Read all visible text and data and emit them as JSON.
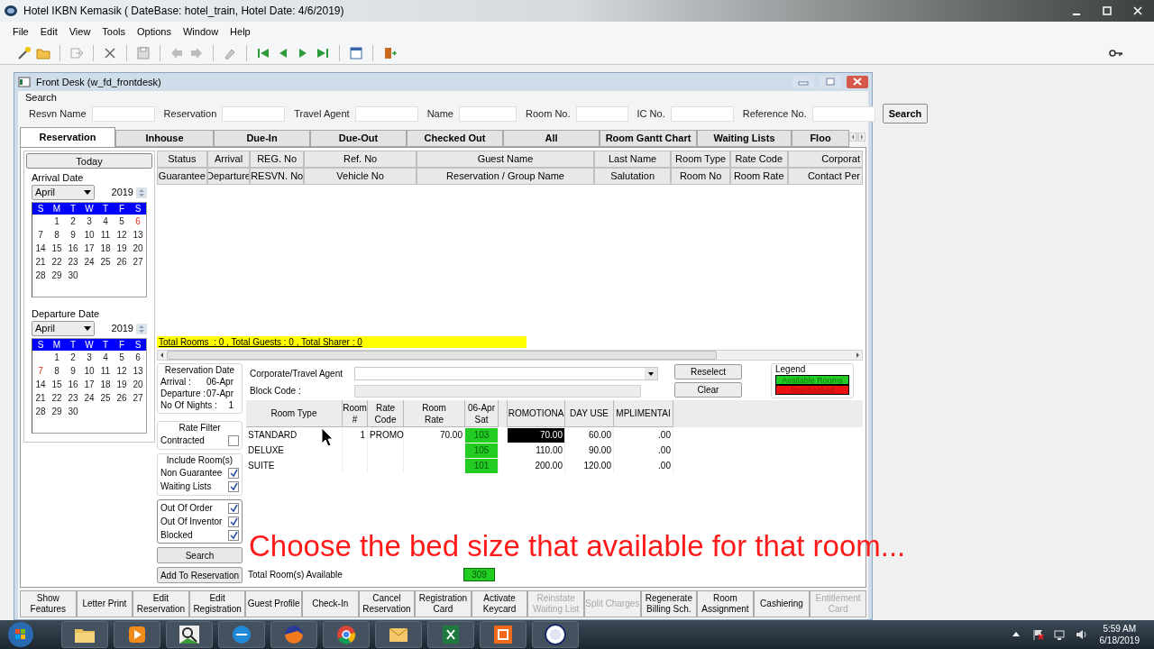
{
  "window": {
    "title": "Hotel IKBN Kemasik ( DateBase: hotel_train, Hotel Date: 4/6/2019)"
  },
  "menu": [
    "File",
    "Edit",
    "View",
    "Tools",
    "Options",
    "Window",
    "Help"
  ],
  "front_desk": {
    "title": "Front Desk (w_fd_frontdesk)",
    "search": {
      "legend": "Search",
      "fields": [
        {
          "label": "Resvn Name"
        },
        {
          "label": "Reservation"
        },
        {
          "label": "Travel Agent"
        },
        {
          "label": "Name"
        },
        {
          "label": "Room No."
        },
        {
          "label": "IC No."
        },
        {
          "label": "Reference No."
        }
      ],
      "button": "Search"
    },
    "tabs": [
      {
        "label": "Reservation",
        "selected": true
      },
      {
        "label": "Inhouse",
        "selected": false
      },
      {
        "label": "Due-In",
        "selected": false
      },
      {
        "label": "Due-Out",
        "selected": false
      },
      {
        "label": "Checked Out",
        "selected": false
      },
      {
        "label": "All",
        "selected": false
      },
      {
        "label": "Room Gantt Chart",
        "selected": false
      },
      {
        "label": "Waiting Lists",
        "selected": false
      },
      {
        "label": "Floo",
        "selected": false
      }
    ],
    "today_button": "Today",
    "calendars": [
      {
        "legend": "Arrival Date",
        "month": "April",
        "year": "2019",
        "weekdays": [
          "S",
          "M",
          "T",
          "W",
          "T",
          "F",
          "S"
        ],
        "weeks": [
          {
            "days": [
              {
                "d": "1",
                "marked": false
              },
              {
                "d": "2",
                "marked": false
              },
              {
                "d": "3",
                "marked": false
              },
              {
                "d": "4",
                "marked": false
              },
              {
                "d": "5",
                "marked": false
              },
              {
                "d": "6",
                "marked": true
              }
            ]
          },
          {
            "days": [
              {
                "d": "7",
                "marked": false
              },
              {
                "d": "8",
                "marked": false
              },
              {
                "d": "9",
                "marked": false
              },
              {
                "d": "10",
                "marked": false
              },
              {
                "d": "11",
                "marked": false
              },
              {
                "d": "12",
                "marked": false
              },
              {
                "d": "13",
                "marked": false
              }
            ]
          },
          {
            "days": [
              {
                "d": "14",
                "marked": false
              },
              {
                "d": "15",
                "marked": false
              },
              {
                "d": "16",
                "marked": false
              },
              {
                "d": "17",
                "marked": false
              },
              {
                "d": "18",
                "marked": false
              },
              {
                "d": "19",
                "marked": false
              },
              {
                "d": "20",
                "marked": false
              }
            ]
          },
          {
            "days": [
              {
                "d": "21",
                "marked": false
              },
              {
                "d": "22",
                "marked": false
              },
              {
                "d": "23",
                "marked": false
              },
              {
                "d": "24",
                "marked": false
              },
              {
                "d": "25",
                "marked": false
              },
              {
                "d": "26",
                "marked": false
              },
              {
                "d": "27",
                "marked": false
              }
            ]
          },
          {
            "days": [
              {
                "d": "28",
                "marked": false
              },
              {
                "d": "29",
                "marked": false
              },
              {
                "d": "30",
                "marked": false
              }
            ]
          }
        ]
      },
      {
        "legend": "Departure Date",
        "month": "April",
        "year": "2019",
        "weekdays": [
          "S",
          "M",
          "T",
          "W",
          "T",
          "F",
          "S"
        ],
        "weeks": [
          {
            "days": [
              {
                "d": "1",
                "marked": false
              },
              {
                "d": "2",
                "marked": false
              },
              {
                "d": "3",
                "marked": false
              },
              {
                "d": "4",
                "marked": false
              },
              {
                "d": "5",
                "marked": false
              },
              {
                "d": "6",
                "marked": false
              }
            ]
          },
          {
            "days": [
              {
                "d": "7",
                "marked": true
              },
              {
                "d": "8",
                "marked": false
              },
              {
                "d": "9",
                "marked": false
              },
              {
                "d": "10",
                "marked": false
              },
              {
                "d": "11",
                "marked": false
              },
              {
                "d": "12",
                "marked": false
              },
              {
                "d": "13",
                "marked": false
              }
            ]
          },
          {
            "days": [
              {
                "d": "14",
                "marked": false
              },
              {
                "d": "15",
                "marked": false
              },
              {
                "d": "16",
                "marked": false
              },
              {
                "d": "17",
                "marked": false
              },
              {
                "d": "18",
                "marked": false
              },
              {
                "d": "19",
                "marked": false
              },
              {
                "d": "20",
                "marked": false
              }
            ]
          },
          {
            "days": [
              {
                "d": "21",
                "marked": false
              },
              {
                "d": "22",
                "marked": false
              },
              {
                "d": "23",
                "marked": false
              },
              {
                "d": "24",
                "marked": false
              },
              {
                "d": "25",
                "marked": false
              },
              {
                "d": "26",
                "marked": false
              },
              {
                "d": "27",
                "marked": false
              }
            ]
          },
          {
            "days": [
              {
                "d": "28",
                "marked": false
              },
              {
                "d": "29",
                "marked": false
              },
              {
                "d": "30",
                "marked": false
              }
            ]
          }
        ]
      }
    ],
    "grid": {
      "columns": [
        {
          "top": "Status",
          "bottom": "Guarantee"
        },
        {
          "top": "Arrival",
          "bottom": "Departure"
        },
        {
          "top": "REG. No",
          "bottom": "RESVN. No"
        },
        {
          "top": "Ref. No",
          "bottom": "Vehicle No"
        },
        {
          "top": "Guest Name",
          "bottom": "Reservation / Group Name"
        },
        {
          "top": "Last Name",
          "bottom": "Salutation"
        },
        {
          "top": "Room Type",
          "bottom": "Room No"
        },
        {
          "top": "Rate Code",
          "bottom": "Room Rate"
        },
        {
          "top": "Corporat",
          "bottom": "Contact Per"
        }
      ],
      "summary": "Total Rooms  : 0 , Total Guests : 0 , Total Sharer : 0"
    },
    "reservation_date": {
      "legend": "Reservation Date",
      "rows": [
        {
          "label": "Arrival :",
          "value": "06-Apr"
        },
        {
          "label": "Departure :",
          "value": "07-Apr"
        },
        {
          "label": "No Of Nights :",
          "value": "1"
        }
      ]
    },
    "rate_filter": {
      "legend": "Rate Filter",
      "options": [
        {
          "label": "Contracted",
          "checked": false
        }
      ]
    },
    "include_rooms": {
      "legend": "Include Room(s)",
      "options": [
        {
          "label": "Non Guarantee",
          "checked": true
        },
        {
          "label": "Waiting Lists",
          "checked": true
        }
      ]
    },
    "room_status_options": [
      {
        "label": "Out Of Order",
        "checked": true
      },
      {
        "label": "Out Of Inventor",
        "checked": true
      },
      {
        "label": "Blocked",
        "checked": true
      }
    ],
    "actions": [
      "Search",
      "Add To Reservation"
    ],
    "corporate_agent": {
      "label": "Corporate/Travel Agent"
    },
    "block_code": {
      "label": "Block Code :",
      "disabled": true
    },
    "buttons": [
      "Reselect",
      "Clear"
    ],
    "legend": {
      "title": "Legend",
      "items": [
        {
          "label": "Available Rooms",
          "color": "#22cc22"
        },
        {
          "label": "Overbooked",
          "color": "#ee1111"
        }
      ]
    },
    "availability": {
      "columns": [
        [
          "Room Type"
        ],
        [
          "Room",
          "#"
        ],
        [
          "Rate",
          "Code"
        ],
        [
          "Room",
          "Rate"
        ],
        [
          "06-Apr",
          "Sat"
        ],
        [
          "ROMOTIONA"
        ],
        [
          "DAY USE"
        ],
        [
          "MPLIMENTAI"
        ]
      ],
      "rows": [
        {
          "room_type": "STANDARD",
          "room_count": "1",
          "rate_code": "PROMO",
          "room_rate": "70.00",
          "date_availability": "103",
          "promotional_rate": "70.00",
          "promotional_selected": true,
          "day_use_rate": "60.00",
          "complimentary_rate": ".00"
        },
        {
          "room_type": "DELUXE",
          "date_availability": "105",
          "promotional_rate": "110.00",
          "promotional_selected": false,
          "day_use_rate": "90.00",
          "complimentary_rate": ".00"
        },
        {
          "room_type": "SUITE",
          "date_availability": "101",
          "promotional_rate": "200.00",
          "promotional_selected": false,
          "day_use_rate": "120.00",
          "complimentary_rate": ".00"
        }
      ],
      "total_label": "Total Room(s) Available",
      "total": "309"
    },
    "footer_buttons": [
      {
        "label": "Show Features",
        "disabled": false
      },
      {
        "label": "Letter Print",
        "disabled": false
      },
      {
        "label": "Edit Reservation",
        "disabled": false
      },
      {
        "label": "Edit Registration",
        "disabled": false
      },
      {
        "label": "Guest Profile",
        "disabled": false
      },
      {
        "label": "Check-In",
        "disabled": false
      },
      {
        "label": "Cancel Reservation",
        "disabled": false
      },
      {
        "label": "Registration Card",
        "disabled": false
      },
      {
        "label": "Activate Keycard",
        "disabled": false
      },
      {
        "label": "Reinstate Waiting List",
        "disabled": true
      },
      {
        "label": "Split Charges",
        "disabled": true
      },
      {
        "label": "Regenerate Billing Sch.",
        "disabled": false
      },
      {
        "label": "Room Assignment",
        "disabled": false
      },
      {
        "label": "Cashiering",
        "disabled": false
      },
      {
        "label": "Entitlement Card",
        "disabled": true
      }
    ]
  },
  "caption": "Choose the bed size that available for that room...",
  "taskbar": {
    "time": "5:59 AM",
    "date": "6/18/2019"
  }
}
